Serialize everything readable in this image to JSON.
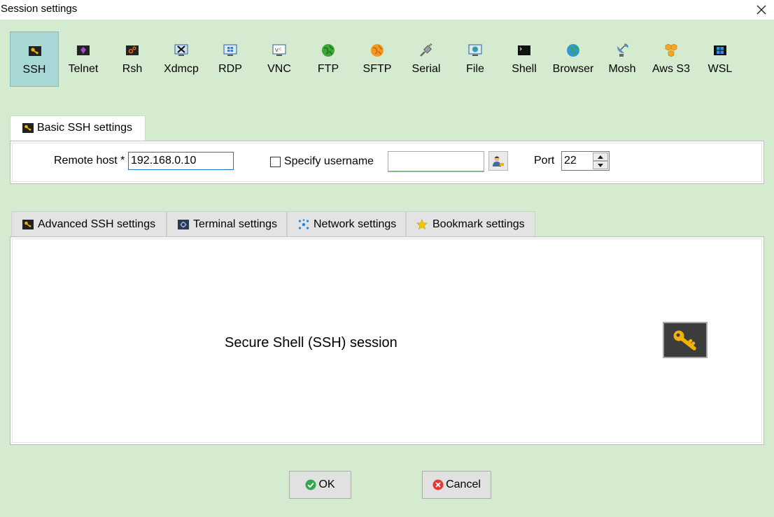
{
  "window": {
    "title": "Session settings",
    "close_icon": "close-icon"
  },
  "session_types": [
    {
      "label": "SSH",
      "icon": "key-icon",
      "selected": true
    },
    {
      "label": "Telnet",
      "icon": "telnet-icon",
      "selected": false
    },
    {
      "label": "Rsh",
      "icon": "rsh-icon",
      "selected": false
    },
    {
      "label": "Xdmcp",
      "icon": "xdmcp-icon",
      "selected": false
    },
    {
      "label": "RDP",
      "icon": "rdp-icon",
      "selected": false
    },
    {
      "label": "VNC",
      "icon": "vnc-icon",
      "selected": false
    },
    {
      "label": "FTP",
      "icon": "ftp-icon",
      "selected": false
    },
    {
      "label": "SFTP",
      "icon": "sftp-icon",
      "selected": false
    },
    {
      "label": "Serial",
      "icon": "serial-icon",
      "selected": false
    },
    {
      "label": "File",
      "icon": "file-icon",
      "selected": false
    },
    {
      "label": "Shell",
      "icon": "shell-icon",
      "selected": false
    },
    {
      "label": "Browser",
      "icon": "browser-icon",
      "selected": false
    },
    {
      "label": "Mosh",
      "icon": "mosh-icon",
      "selected": false
    },
    {
      "label": "Aws S3",
      "icon": "aws-s3-icon",
      "selected": false
    },
    {
      "label": "WSL",
      "icon": "wsl-icon",
      "selected": false
    }
  ],
  "basic": {
    "tab_label": "Basic SSH settings",
    "remote_host_label": "Remote host *",
    "remote_host_value": "192.168.0.10",
    "specify_username_label": "Specify username",
    "specify_username_checked": false,
    "username_value": "",
    "port_label": "Port",
    "port_value": "22"
  },
  "tabs": [
    {
      "label": "Advanced SSH settings",
      "icon": "key-icon"
    },
    {
      "label": "Terminal settings",
      "icon": "terminal-icon"
    },
    {
      "label": "Network settings",
      "icon": "network-icon"
    },
    {
      "label": "Bookmark settings",
      "icon": "star-icon"
    }
  ],
  "panel": {
    "description": "Secure Shell (SSH) session",
    "icon": "key-icon"
  },
  "buttons": {
    "ok_label": "OK",
    "cancel_label": "Cancel"
  },
  "colors": {
    "background": "#d5ebcf",
    "selected_type": "#a7d8d6",
    "input_focus": "#1a73c8"
  }
}
